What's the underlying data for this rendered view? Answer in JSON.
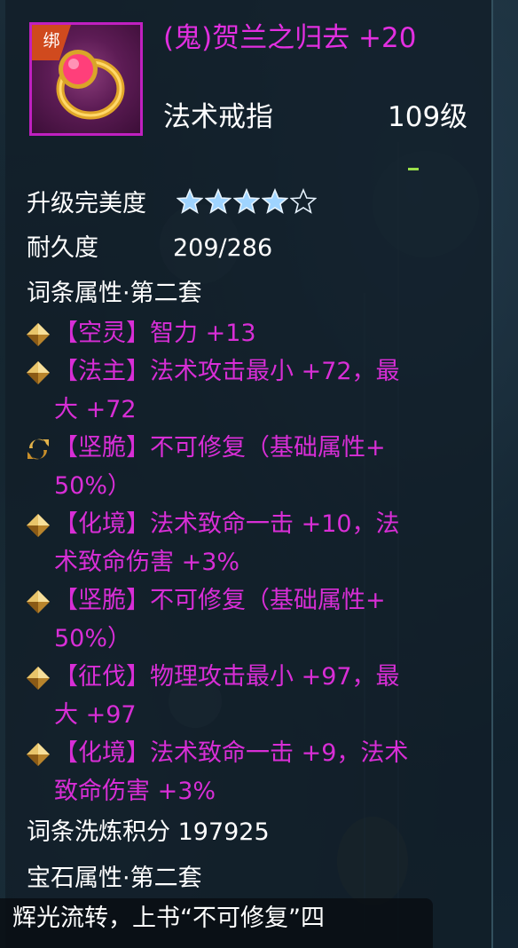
{
  "item": {
    "bind_badge": "绑",
    "title": "(鬼)贺兰之归去 +20",
    "type": "法术戒指",
    "level": "109级"
  },
  "stats": {
    "perfection_label": "升级完美度",
    "perfection_stars": 4,
    "perfection_stars_max": 5,
    "durability_label": "耐久度",
    "durability_value": "209/286"
  },
  "attributes": {
    "header": "词条属性·第二套",
    "items": [
      {
        "icon": "gold-diamond-icon",
        "line1": "【空灵】智力 +13",
        "line2": ""
      },
      {
        "icon": "gold-diamond-icon",
        "line1": "【法主】法术攻击最小 +72，最",
        "line2": "大 +72"
      },
      {
        "icon": "refresh-swap-icon",
        "line1": "【坚脆】不可修复（基础属性+",
        "line2": "50%）"
      },
      {
        "icon": "gold-diamond-icon",
        "line1": "【化境】法术致命一击 +10，法",
        "line2": "术致命伤害 +3%"
      },
      {
        "icon": "gold-diamond-icon",
        "line1": "【坚脆】不可修复（基础属性+",
        "line2": "50%）"
      },
      {
        "icon": "gold-diamond-icon",
        "line1": "【征伐】物理攻击最小 +97，最",
        "line2": "大 +97"
      },
      {
        "icon": "gold-diamond-icon",
        "line1": "【化境】法术致命一击 +9，法术",
        "line2": "致命伤害 +3%"
      }
    ]
  },
  "refine_score": {
    "label": "词条洗炼积分 197925"
  },
  "gem": {
    "header": "宝石属性·第二套"
  },
  "chat_bubble": {
    "text": "辉光流转，上书“不可修复”四"
  },
  "colors": {
    "title": "#e22fe0",
    "attribute_text": "#d82ed6",
    "icon_border": "#c020c0",
    "star_fill": "#9fd4ff",
    "bind_badge": "#d04a1e"
  }
}
